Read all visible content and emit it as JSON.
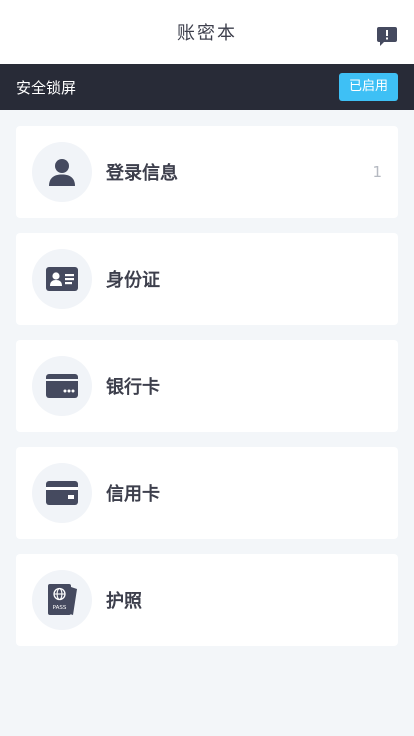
{
  "header": {
    "title": "账密本",
    "feedback_icon": "feedback-icon"
  },
  "lock": {
    "label": "安全锁屏",
    "status": "已启用",
    "status_color": "#3ec0f5"
  },
  "categories": [
    {
      "label": "登录信息",
      "count": "1",
      "icon": "user-icon"
    },
    {
      "label": "身份证",
      "count": "",
      "icon": "id-card-icon"
    },
    {
      "label": "银行卡",
      "count": "",
      "icon": "bank-card-icon"
    },
    {
      "label": "信用卡",
      "count": "",
      "icon": "credit-card-icon"
    },
    {
      "label": "护照",
      "count": "",
      "icon": "passport-icon"
    }
  ],
  "colors": {
    "icon": "#454a5f",
    "bar": "#282b37",
    "background": "#f3f6f9"
  }
}
